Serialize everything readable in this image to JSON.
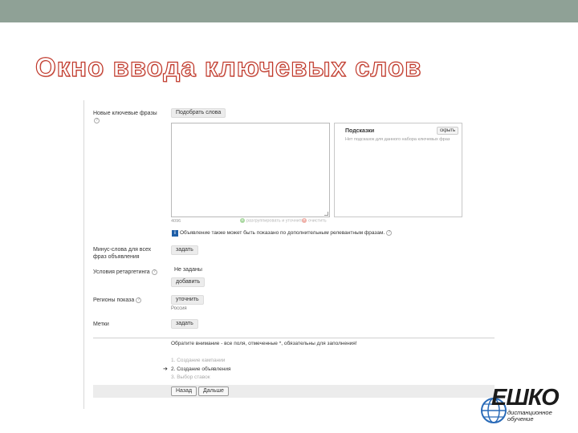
{
  "slide": {
    "title": "Окно ввода ключевых слов"
  },
  "form": {
    "new_keywords_label": "Новые ключевые фразы",
    "pick_words_button": "Подобрать слова",
    "hints": {
      "title": "Подсказки",
      "hide_button": "скрыть",
      "empty_text": "Нет подсказок для данного набора ключевых фраз"
    },
    "char_counter": "4096",
    "group_action": "разгруппировать и уточнить",
    "clear_action": "очистить",
    "info_note": "Объявление также может быть показано по дополнительным релевантным фразам.",
    "minus_words_label": "Минус-слова для всех фраз объявления",
    "minus_words_button": "задать",
    "retargeting_label": "Условия ретаргетинга",
    "retargeting_value": "Не заданы",
    "retargeting_button": "добавить",
    "regions_label": "Регионы показа",
    "regions_button": "уточнить",
    "regions_value": "Россия",
    "tags_label": "Метки",
    "tags_button": "задать",
    "required_note": "Обратите внимание - все поля, отмеченные *, обязательны для заполнения!",
    "steps": [
      "1. Создание кампании",
      "2. Создание объявления",
      "3. Выбор ставок"
    ],
    "current_step_marker": "➔",
    "back_button": "Назад",
    "next_button": "Дальше"
  },
  "logo": {
    "name": "ЕШКО",
    "subtitle": "дистанционное обучение"
  },
  "colors": {
    "top_bar": "#8fa196",
    "title_outline": "#c0392b",
    "info_icon": "#1f5fa8"
  }
}
